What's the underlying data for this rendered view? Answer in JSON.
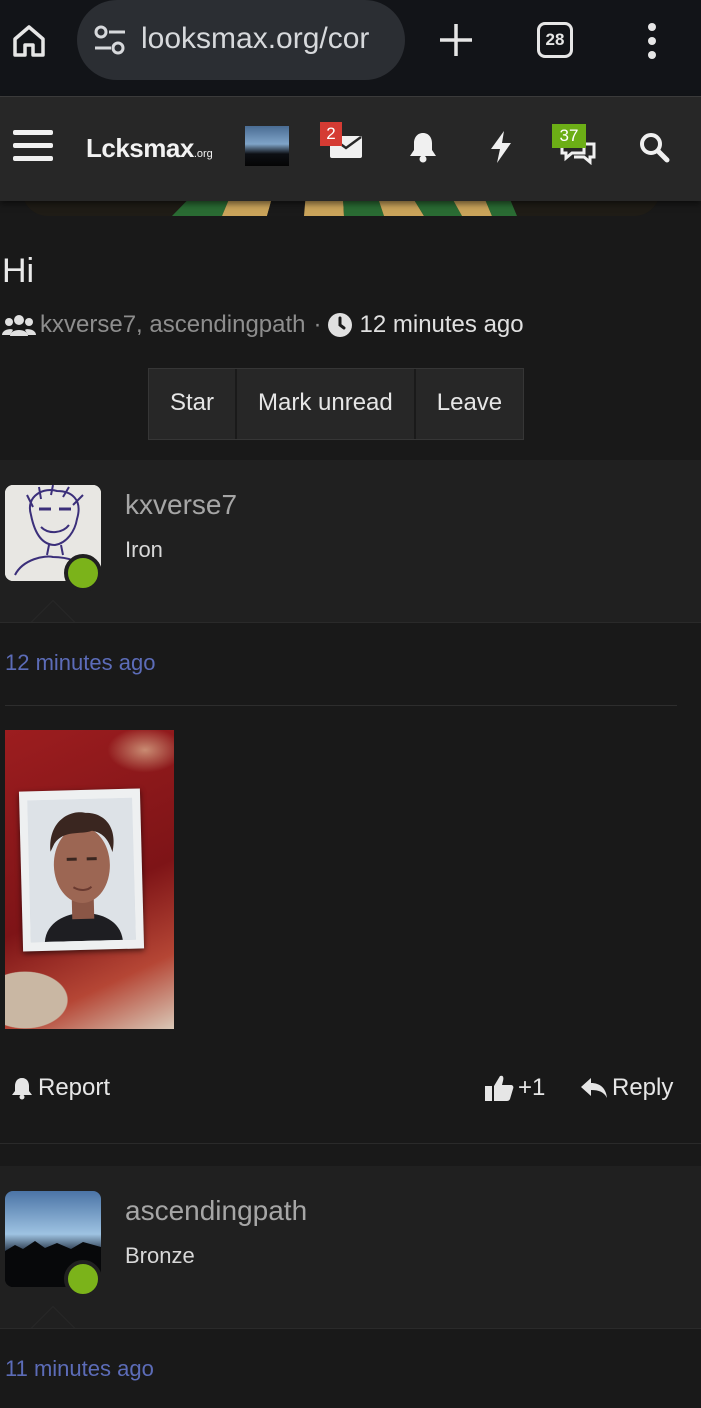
{
  "browser": {
    "url": "looksmax.org/cor",
    "tab_count": "28"
  },
  "site": {
    "logo": "Lcksmax",
    "logo_suffix": ".org",
    "inbox_badge": "2",
    "alerts_badge": "37"
  },
  "conversation": {
    "title": "Hi",
    "participants": "kxverse7, ascendingpath",
    "separator": "·",
    "time": "12 minutes ago",
    "buttons": {
      "star": "Star",
      "mark_unread": "Mark unread",
      "leave": "Leave"
    }
  },
  "messages": [
    {
      "username": "kxverse7",
      "rank": "Iron",
      "time": "12 minutes ago",
      "report": "Report",
      "likes": "+1",
      "reply": "Reply"
    },
    {
      "username": "ascendingpath",
      "rank": "Bronze",
      "time": "11 minutes ago"
    }
  ],
  "colors": {
    "background": "#191919",
    "panel": "#202020",
    "nav": "#272727",
    "timestamp": "#5c6cb8",
    "online": "#7bb31a",
    "badge_red": "#d53b33",
    "badge_green": "#6cae16"
  }
}
